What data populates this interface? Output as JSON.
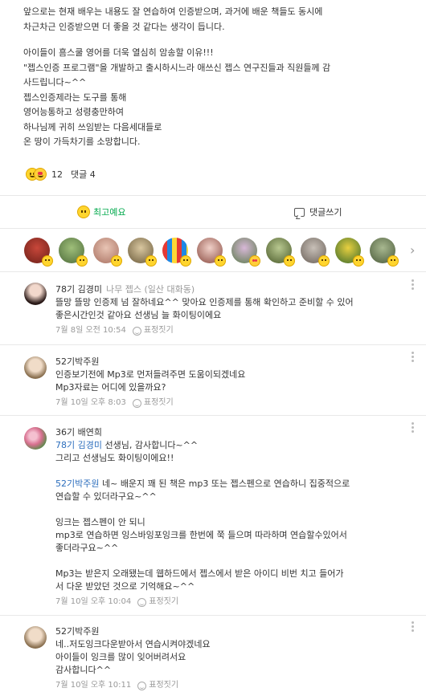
{
  "post": {
    "paragraphs": [
      [
        "앞으로는 현재 배우는 내용도 잘 연습하여 인증받으며, 과거에 배운 책들도 동시에",
        "차근차근 인증받으면 더 좋을 것 같다는 생각이 듭니다."
      ],
      [
        "아이들이 흠스쿨 영어를 더욱 열심히 암송할 이유!!!",
        "\"젭스인증 프로그램\"을 개발하고 출시하시느라 애쓰신 젭스 연구진들과 직원들께 감",
        "사드립니다~^^",
        "젭스인증제라는 도구를 통해",
        "영어능통하고 성령충만하여",
        "하나님께 귀히 쓰임받는 다음세대들로",
        "온 땅이 가득차기를 소망합니다."
      ]
    ]
  },
  "reactions": {
    "count": "12",
    "comments_label": "댓글 4"
  },
  "actions": {
    "like_label": "최고예요",
    "comment_label": "댓글쓰기"
  },
  "colors": {
    "accent_green": "#03a94d",
    "mention_blue": "#2c6ebd",
    "meta_gray": "#999999",
    "emoji_yellow": "#ffd52e"
  },
  "reactor_strip": {
    "count_visible": 11,
    "next_icon": "chevron-right-icon"
  },
  "comments": [
    {
      "author": "78기 김경미",
      "tag": "나무 젭스 (일산 대화동)",
      "lines": [
        "뜰망 뜰망 인증제 넘 잘하네요^^ 맞아요 인증제를 통해 확인하고 준비할 수 있어",
        "좋은시간인것 같아요 선생님 늘 화이팅이에요"
      ],
      "date": "7월 8일 오전 10:54",
      "react_label": "표정짓기"
    },
    {
      "author": "52기박주원",
      "tag": "",
      "lines": [
        "인증보기전에 Mp3로 먼저들려주면 도움이되겠네요",
        "Mp3자료는 어디에 있을까요?"
      ],
      "date": "7월 10일 오후 8:03",
      "react_label": "표정짓기"
    },
    {
      "author": "36기 배연희",
      "tag": "",
      "mention1": "78기 김경미",
      "lines_a": [
        " 선생님, 감사합니다~^^",
        "그리고 선생님도 화이팅이에요!!"
      ],
      "mention2": "52기박주원",
      "lines_b": [
        " 네~ 배운지 꽤 된 책은 mp3 또는 젭스펜으로 연습하니 집중적으로",
        "연습할 수 있더라구요~^^"
      ],
      "lines_c": [
        "잉크는 젭스펜이 안 되니",
        "mp3로 연습하면 잉스바잉포잉크를 한번에 쭉 들으며 따라하며 연습할수있어서",
        "좋더라구요~^^"
      ],
      "lines_d": [
        "Mp3는 받은지 오래됐는데 웹하드에서 젭스에서 받은 아이디 비번 치고 들어가",
        "서  다운 받았던 것으로 기억해요~^^"
      ],
      "date": "7월 10일 오후 10:04",
      "react_label": "표정짓기"
    },
    {
      "author": "52기박주원",
      "tag": "",
      "lines": [
        "네..저도잉크다운받아서 연습시켜야겠네요",
        "아이들이 잉크를 많이 잊어버려서요",
        "감사합니다^^"
      ],
      "date": "7월 10일 오후 10:11",
      "react_label": "표정짓기"
    }
  ]
}
